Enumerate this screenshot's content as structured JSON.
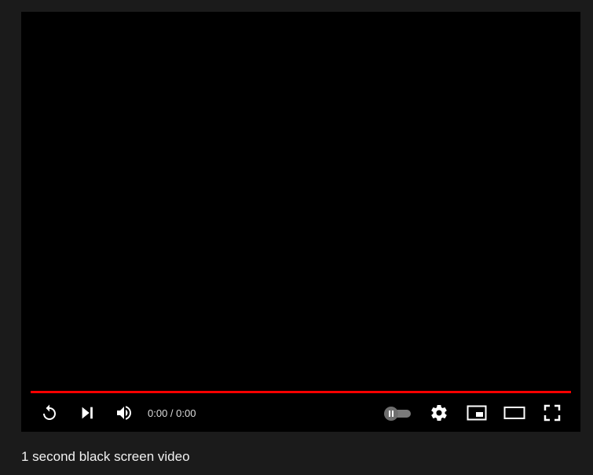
{
  "player": {
    "progress": 1.0,
    "progress_color": "#ff0000",
    "background": "#000000",
    "time_display": "0:00 / 0:00",
    "controls": {
      "replay": "replay-icon",
      "next": "next-icon",
      "volume": "volume-icon",
      "autoplay": "autoplay-toggle",
      "settings": "gear-icon",
      "miniplayer": "miniplayer-icon",
      "theater": "theater-mode-icon",
      "fullscreen": "fullscreen-icon"
    },
    "autoplay_on": false
  },
  "video": {
    "title": "1 second black screen video"
  },
  "colors": {
    "page_background": "#1b1b1b",
    "icon": "#ffffff",
    "title_text": "#f1f1f1"
  }
}
